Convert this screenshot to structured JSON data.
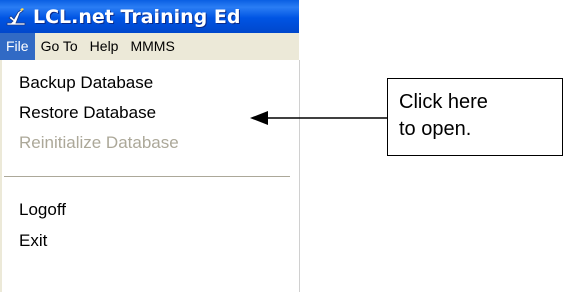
{
  "window": {
    "title": "LCL.net Training Ed",
    "icon": "app-logo-icon"
  },
  "menubar": {
    "items": [
      {
        "label": "File",
        "active": true
      },
      {
        "label": "Go To"
      },
      {
        "label": "Help"
      },
      {
        "label": "MMMS"
      }
    ]
  },
  "file_menu": {
    "items": [
      {
        "label": "Backup Database",
        "enabled": true
      },
      {
        "label": "Restore Database",
        "enabled": true
      },
      {
        "label": "Reinitialize Database",
        "enabled": false
      },
      {
        "label": "Logoff",
        "enabled": true
      },
      {
        "label": "Exit",
        "enabled": true
      }
    ]
  },
  "callout": {
    "line1": "Click here",
    "line2": "to open."
  },
  "colors": {
    "title_bar": "#0054e3",
    "menu_highlight": "#316ac5",
    "disabled_text": "#aca899",
    "menu_background": "#ece9d8"
  }
}
